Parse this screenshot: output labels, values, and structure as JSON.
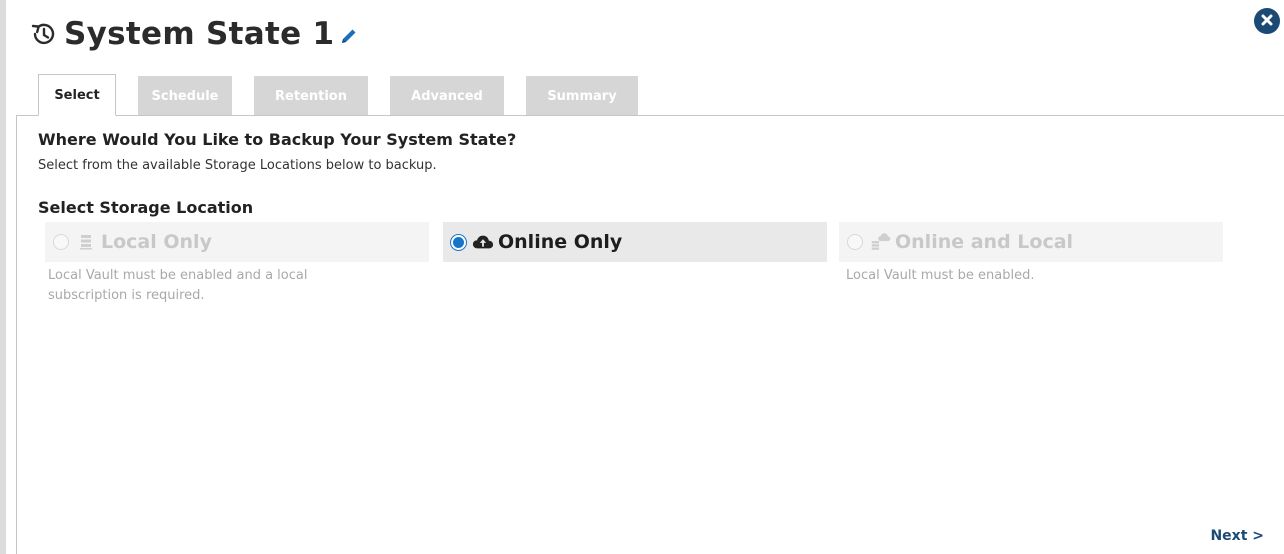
{
  "window": {
    "title": "System State 1",
    "history_icon": "history-icon",
    "edit_icon": "pencil-icon",
    "close_icon": "close-icon"
  },
  "tabs": [
    {
      "label": "Select",
      "active": true
    },
    {
      "label": "Schedule",
      "active": false
    },
    {
      "label": "Retention",
      "active": false
    },
    {
      "label": "Advanced",
      "active": false
    },
    {
      "label": "Summary",
      "active": false
    }
  ],
  "content": {
    "heading": "Where Would You Like to Backup Your System State?",
    "subheading": "Select from the available Storage Locations below to backup.",
    "section_title": "Select Storage Location",
    "options": [
      {
        "label": "Local Only",
        "icon": "server-icon",
        "selected": false,
        "enabled": false,
        "note": "Local Vault must be enabled and a local subscription is required."
      },
      {
        "label": "Online Only",
        "icon": "cloud-upload-icon",
        "selected": true,
        "enabled": true,
        "note": ""
      },
      {
        "label": "Online and Local",
        "icon": "server-cloud-icon",
        "selected": false,
        "enabled": false,
        "note": "Local Vault must be enabled."
      }
    ]
  },
  "footer": {
    "next_label": "Next >"
  },
  "colors": {
    "accent": "#1775c9",
    "brand_dark": "#1b4a75",
    "disabled_text": "#c8c8c8",
    "tab_inactive_bg": "#d6d6d6"
  }
}
